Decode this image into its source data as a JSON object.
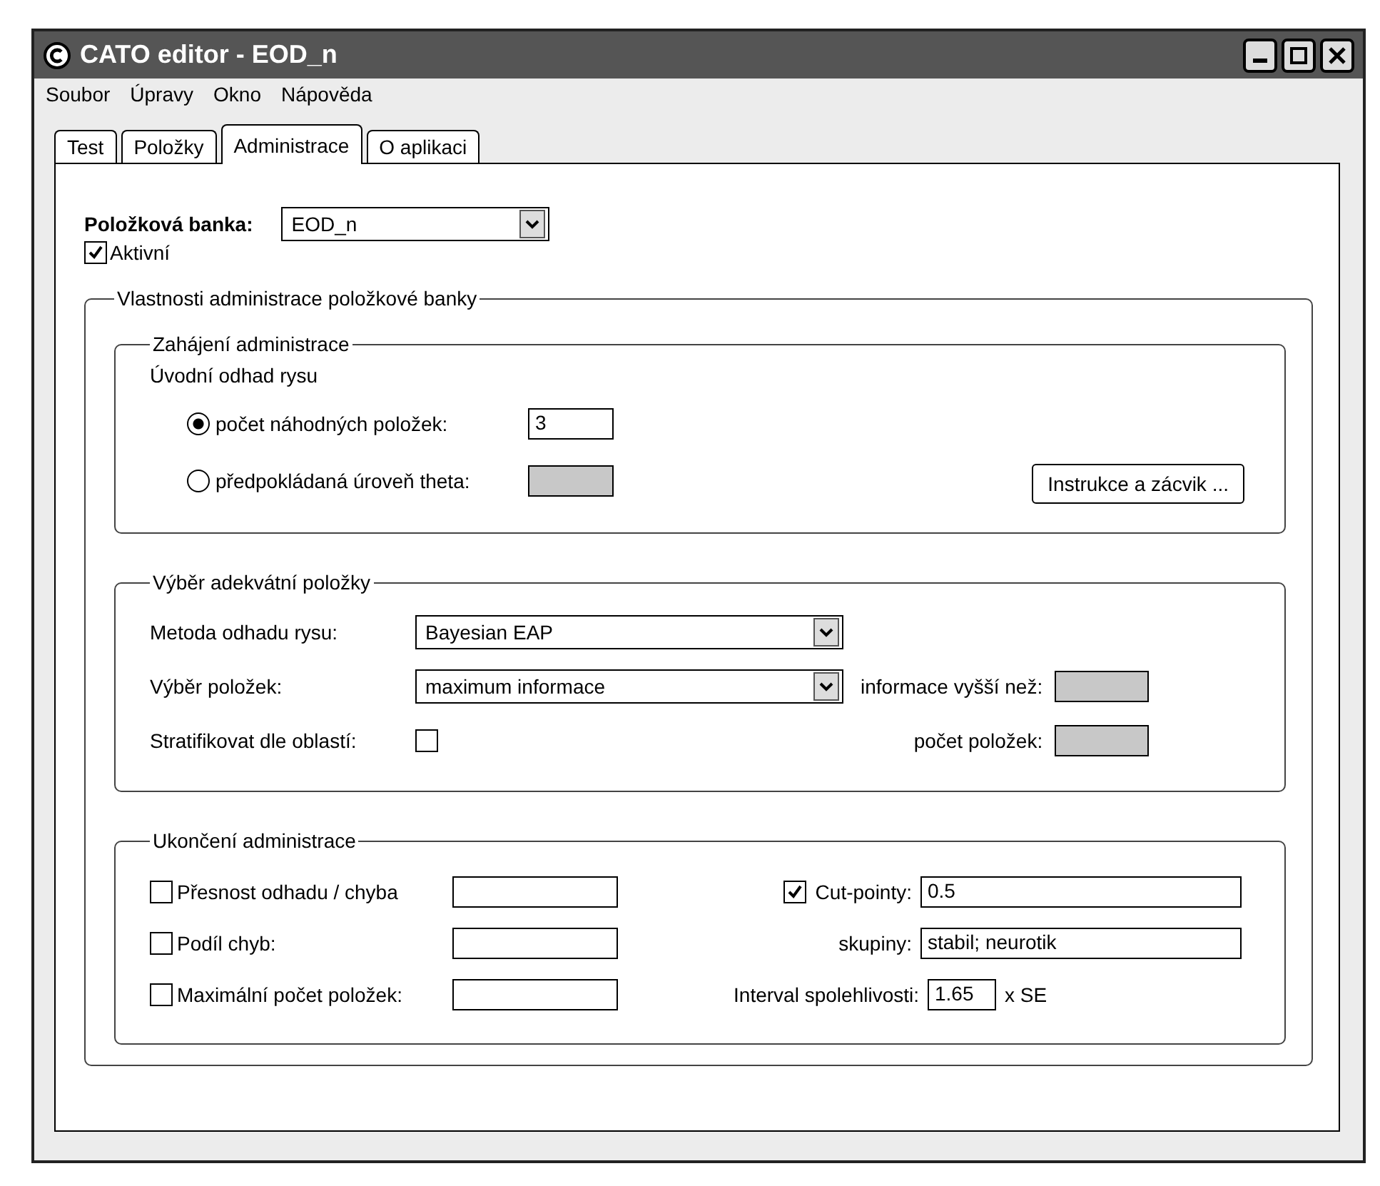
{
  "window": {
    "title": "CATO editor - EOD_n"
  },
  "menu": [
    "Soubor",
    "Úpravy",
    "Okno",
    "Nápověda"
  ],
  "tabs": [
    {
      "label": "Test",
      "selected": false
    },
    {
      "label": "Položky",
      "selected": false
    },
    {
      "label": "Administrace",
      "selected": true
    },
    {
      "label": "O aplikaci",
      "selected": false
    }
  ],
  "bank": {
    "label": "Položková banka:",
    "value": "EOD_n",
    "active": {
      "label": "Aktivní",
      "checked": true
    }
  },
  "properties": {
    "title": "Vlastnosti administrace položkové banky",
    "start": {
      "title": "Zahájení administrace",
      "subtitle": "Úvodní odhad rysu",
      "options": [
        {
          "label": "počet náhodných položek:",
          "selected": true,
          "value": "3",
          "disabled": false
        },
        {
          "label": "předpokládaná úroveň theta:",
          "selected": false,
          "disabled": true
        }
      ],
      "button": "Instrukce a zácvik ..."
    },
    "selection": {
      "title": "Výběr adekvátní položky",
      "method": {
        "label": "Metoda odhadu rysu:",
        "value": "Bayesian EAP"
      },
      "items": {
        "label": "Výběr položek:",
        "value": "maximum informace"
      },
      "stratify": {
        "label": "Stratifikovat dle oblastí:",
        "checked": false
      },
      "side_fields": [
        {
          "label": "informace vyšší než:",
          "disabled": true
        },
        {
          "label": "počet položek:",
          "disabled": true
        }
      ]
    },
    "end": {
      "title": "Ukončení administrace",
      "criteria": [
        {
          "label": "Přesnost odhadu / chyba",
          "checked": false
        },
        {
          "label": "Podíl chyb:",
          "checked": false
        },
        {
          "label": "Maximální počet položek:",
          "checked": false
        }
      ],
      "cut_points": {
        "label": "Cut-pointy:",
        "checked": true,
        "value": "0.5"
      },
      "groups": {
        "label": "skupiny:",
        "value": "stabil; neurotik"
      },
      "interval": {
        "label": "Interval spolehlivosti:",
        "value": "1.65",
        "unit": "x SE"
      }
    }
  }
}
